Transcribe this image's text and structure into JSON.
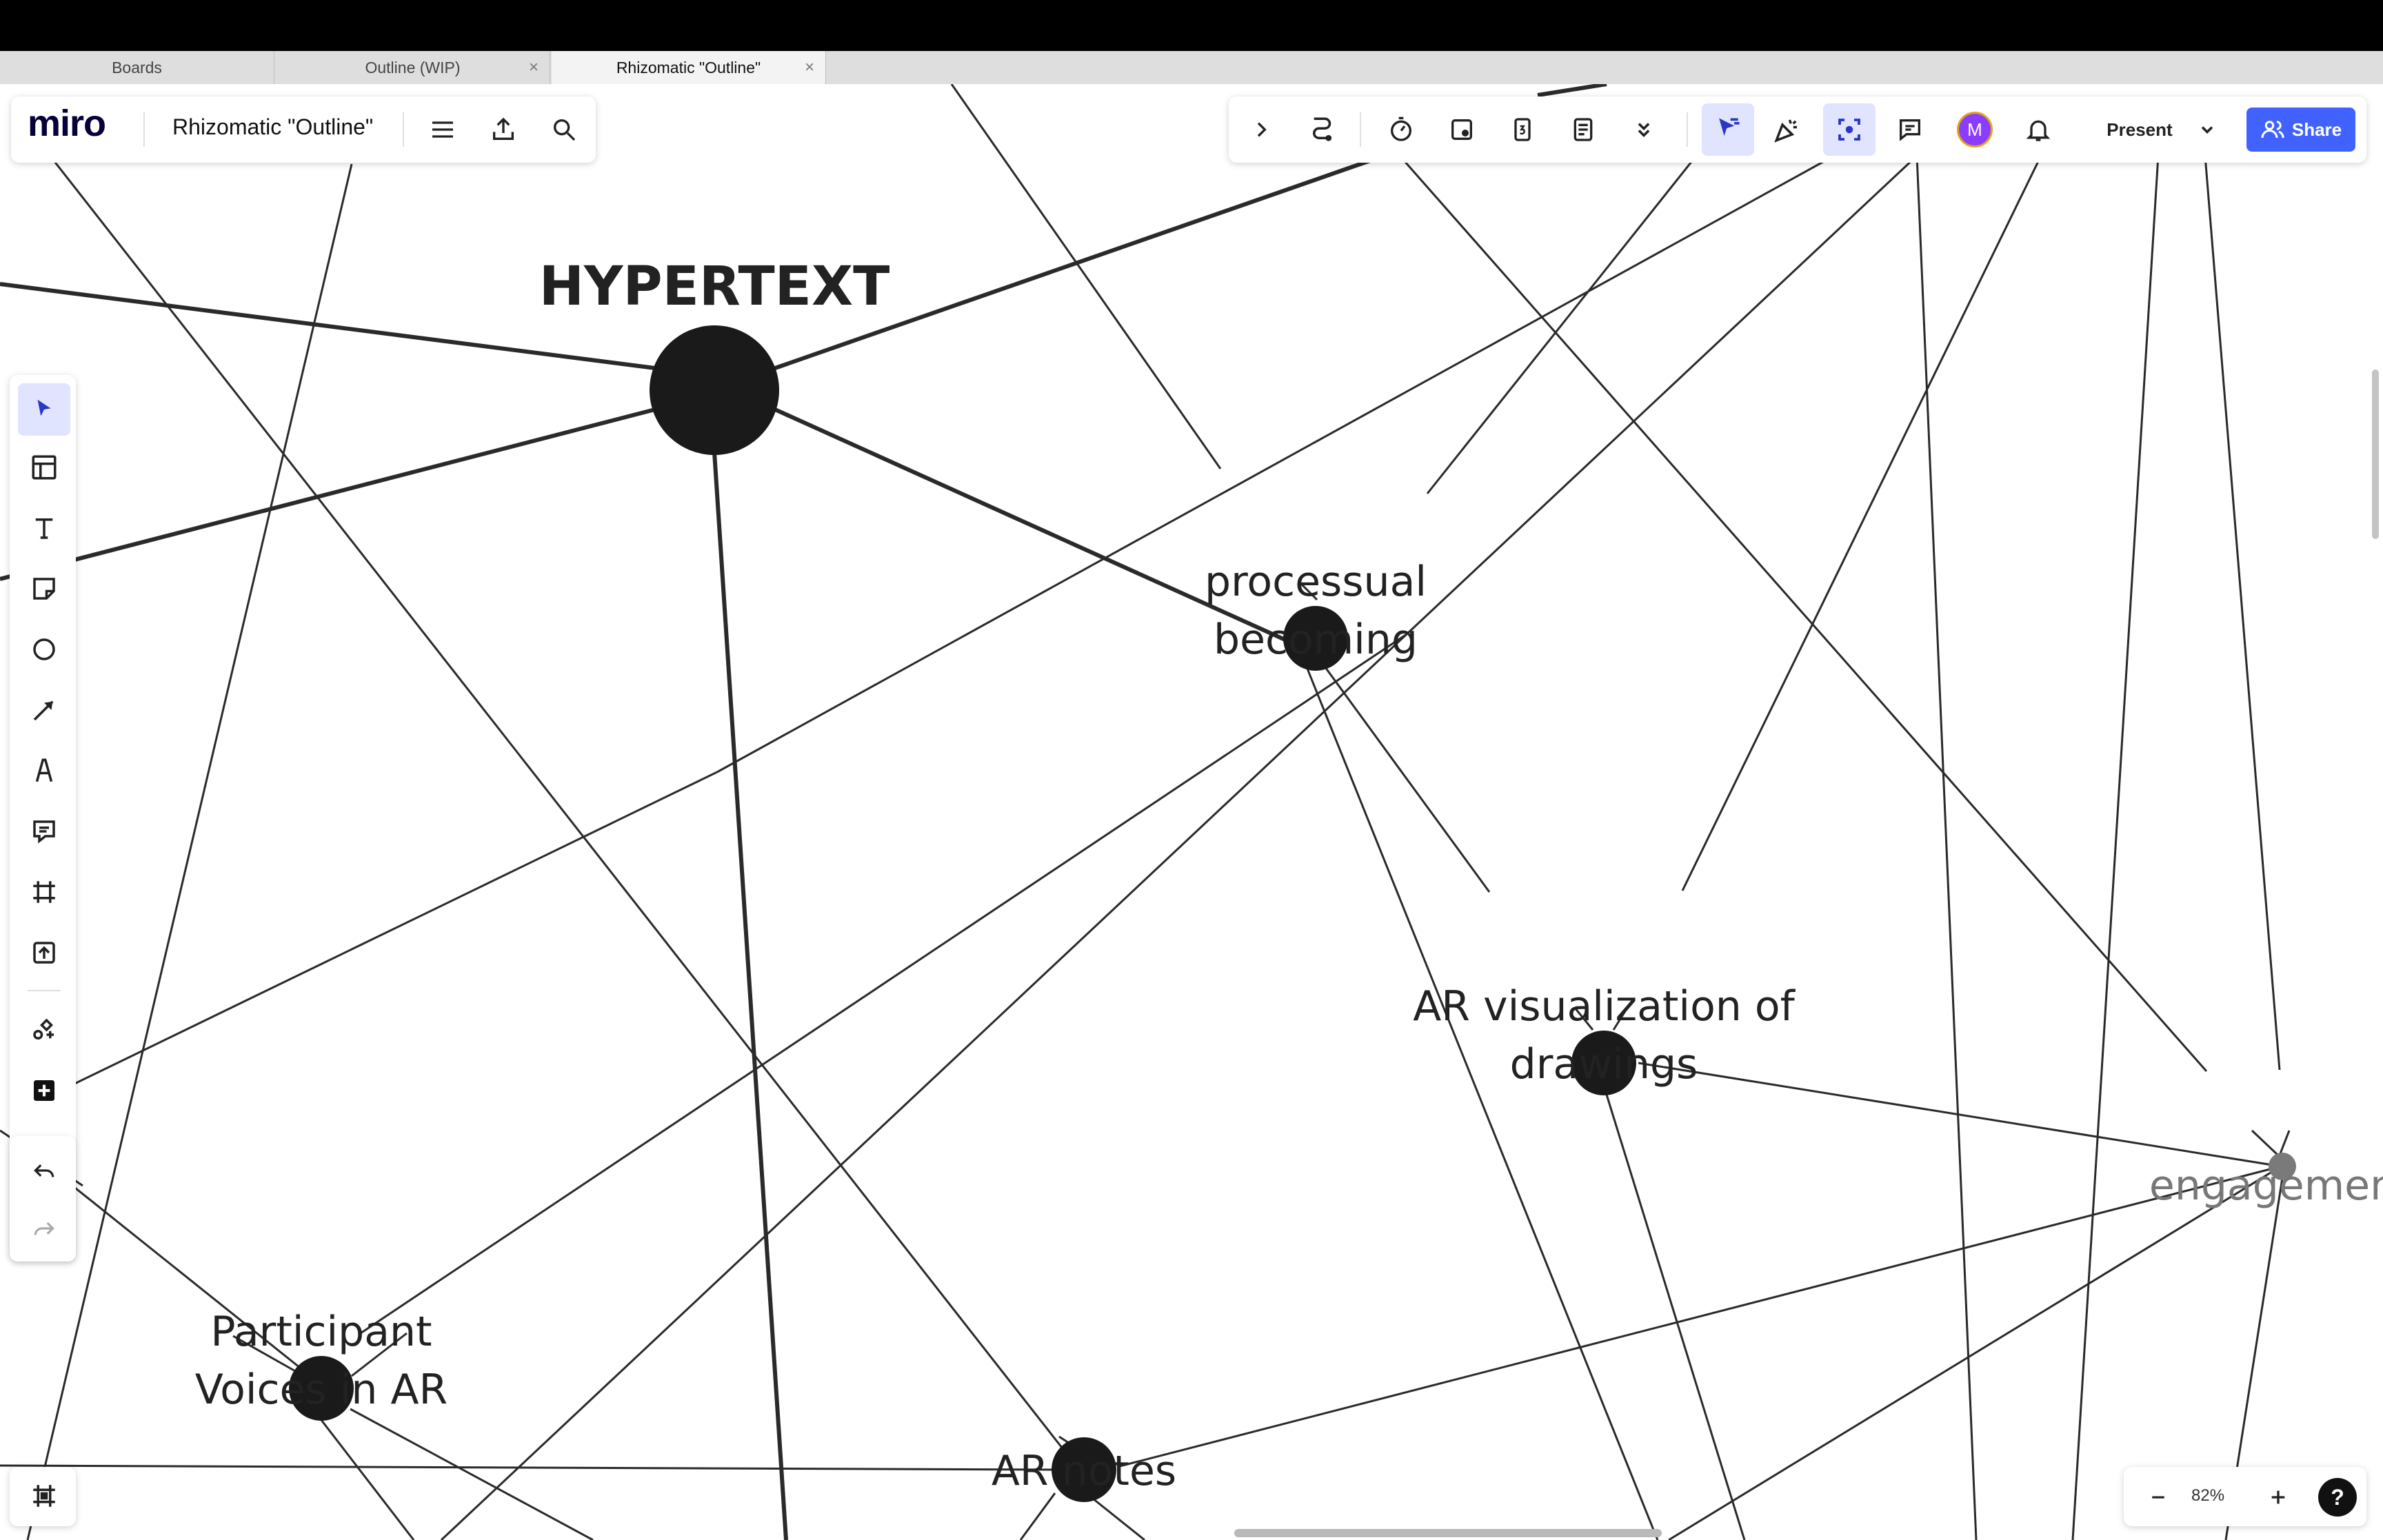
{
  "browser": {
    "tabs": [
      {
        "label": "Boards"
      },
      {
        "label": "Outline (WIP)"
      },
      {
        "label": "Rhizomatic \"Outline\""
      }
    ]
  },
  "header": {
    "logo": "miro",
    "board_title": "Rhizomatic \"Outline\""
  },
  "toolbar": {
    "present_label": "Present",
    "share_label": "Share",
    "avatar_initial": "M"
  },
  "canvas": {
    "nodes": [
      {
        "label": "HYPERTEXT"
      },
      {
        "label": "processual\nbecoming"
      },
      {
        "label": "AR visualization of\ndrawings"
      },
      {
        "label": "engagemen"
      },
      {
        "label": "Participant\nVoices in AR"
      },
      {
        "label": "AR notes"
      }
    ]
  },
  "zoom": {
    "value": "82%"
  },
  "help_label": "?",
  "colors": {
    "accent": "#4262ff",
    "node": "#1a1a1a",
    "node_faded": "#7a7a7a",
    "selected_tool_bg": "#e0e4ff"
  }
}
